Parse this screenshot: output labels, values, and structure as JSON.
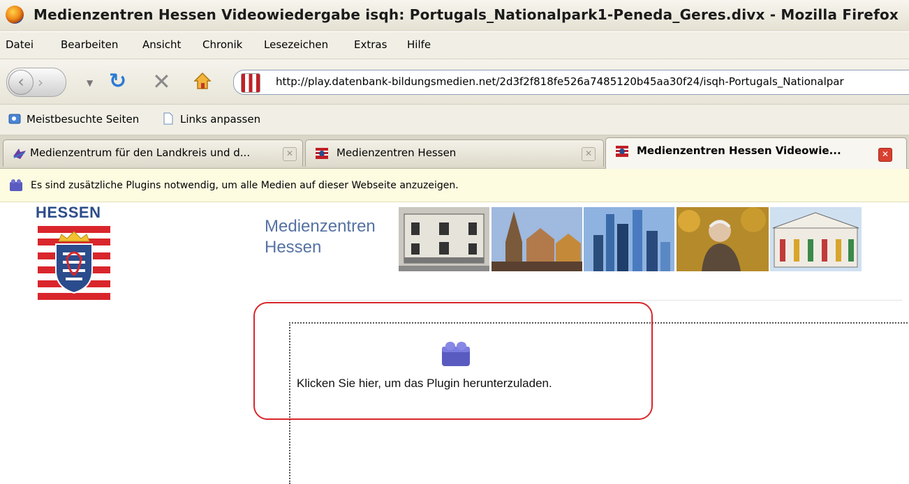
{
  "window": {
    "title": "Medienzentren Hessen Videowiedergabe isqh: Portugals_Nationalpark1-Peneda_Geres.divx - Mozilla Firefox",
    "app_icon": "firefox-logo-icon"
  },
  "menubar": {
    "items": [
      "Datei",
      "Bearbeiten",
      "Ansicht",
      "Chronik",
      "Lesezeichen",
      "Extras",
      "Hilfe"
    ]
  },
  "navbar": {
    "url": "http://play.datenbank-bildungsmedien.net/2d3f2f818fe526a7485120b45aa30f24/isqh-Portugals_Nationalpar",
    "icons": [
      "back-icon",
      "forward-icon",
      "history-dropdown-icon",
      "reload-icon",
      "stop-icon",
      "home-icon",
      "site-favicon-icon"
    ]
  },
  "bookmarks": {
    "items": [
      "Meistbesuchte Seiten",
      "Links anpassen"
    ]
  },
  "tabs": [
    {
      "label": "Medienzentrum für den Landkreis und d...",
      "active": false
    },
    {
      "label": "Medienzentren Hessen",
      "active": false
    },
    {
      "label": "Medienzentren Hessen Videowie...",
      "active": true
    }
  ],
  "plugin_bar": {
    "message": "Es sind zusätzliche Plugins notwendig, um alle Medien auf dieser Webseite anzuzeigen."
  },
  "page": {
    "state_label": "HESSEN",
    "org_name_line1": "Medienzentren",
    "org_name_line2": "Hessen",
    "plugin_prompt": "Klicken Sie hier, um das Plugin herunterzuladen.",
    "highlight_color": "#d9262c"
  }
}
